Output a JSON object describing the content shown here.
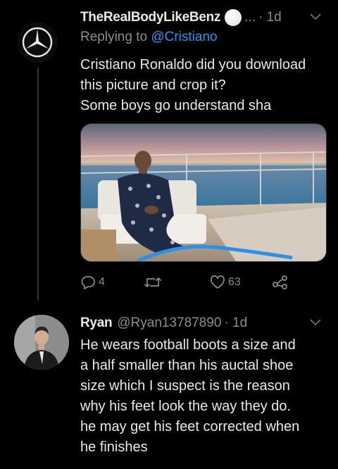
{
  "tweet1": {
    "display_name": "TheRealBodyLikeBenz",
    "name_suffix": "...",
    "time": "· 1d",
    "replying_prefix": "Replying to ",
    "replying_to": "@Cristiano",
    "text_lines": [
      "Cristiano Ronaldo did you download",
      "this picture and crop it?",
      "Some boys go understand sha"
    ],
    "actions": {
      "reply_count": "4",
      "retweet_count": "",
      "like_count": "63"
    }
  },
  "tweet2": {
    "display_name": "Ryan",
    "handle": "@Ryan13787890",
    "time": "· 1d",
    "text_lines": [
      "He wears football boots a size and",
      "a half smaller than his auctal shoe",
      "size which I suspect is the reason",
      "why his feet look the way they do.",
      "he may get his feet corrected when",
      "he finishes"
    ]
  },
  "icons": {
    "avatar1": "mercedes-star-logo",
    "verified_like_emoji": "white-circle-emoji",
    "menu": "chevron-down-icon",
    "reply": "reply-icon",
    "retweet": "retweet-icon",
    "like": "heart-icon",
    "share": "share-icon"
  },
  "colors": {
    "background": "#000000",
    "text": "#e7e9ea",
    "secondary": "#8a8d91",
    "link": "#1d9bf0"
  }
}
